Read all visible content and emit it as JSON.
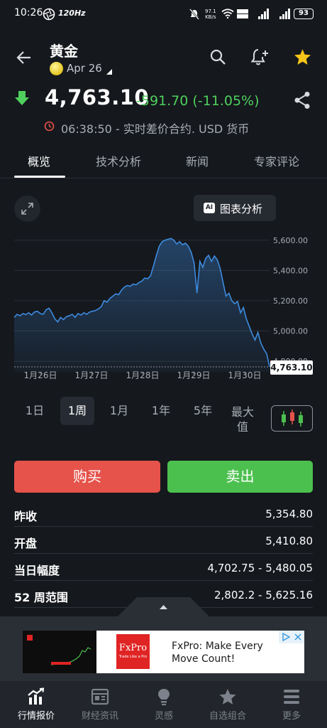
{
  "status_bar": {
    "time": "10:26",
    "refresh_rate": "120Hz",
    "net_speed": "97.1",
    "net_unit": "KB/s",
    "battery": "93"
  },
  "header": {
    "title": "黄金",
    "date": "Apr 26",
    "back_icon": "arrow-left-icon",
    "search_icon": "search-icon",
    "alert_icon": "bell-plus-icon",
    "star_icon": "star-icon",
    "star_color": "#f5c518"
  },
  "quote": {
    "price": "4,763.10",
    "change": "-591.70 (-11.05%)",
    "direction_icon": "arrow-down-icon",
    "direction_color": "#4fcf5d",
    "time": "06:38:50",
    "info": "- 实时差价合约. USD 货币"
  },
  "tabs": [
    {
      "label": "概览",
      "active": true
    },
    {
      "label": "技术分析",
      "active": false
    },
    {
      "label": "新闻",
      "active": false
    },
    {
      "label": "专家评论",
      "active": false
    }
  ],
  "chart_tools": {
    "analysis_label": "图表分析",
    "ai_badge": "AI"
  },
  "chart_data": {
    "type": "area",
    "x_ticks": [
      "1月26日",
      "1月27日",
      "1月28日",
      "1月29日",
      "1月30日"
    ],
    "y_ticks": [
      "5,600.00",
      "5,400.00",
      "5,200.00",
      "5,000.00",
      "4,800.00"
    ],
    "ylim": [
      4730,
      5660
    ],
    "last_value_label": "4,763.10",
    "values": [
      5090,
      5110,
      5100,
      5115,
      5108,
      5120,
      5105,
      5125,
      5130,
      5115,
      5110,
      5140,
      5150,
      5120,
      5080,
      5060,
      5090,
      5075,
      5095,
      5100,
      5110,
      5090,
      5115,
      5105,
      5120,
      5110,
      5125,
      5130,
      5135,
      5145,
      5160,
      5200,
      5190,
      5215,
      5230,
      5245,
      5240,
      5270,
      5290,
      5300,
      5295,
      5310,
      5305,
      5320,
      5330,
      5350,
      5345,
      5365,
      5430,
      5500,
      5560,
      5590,
      5600,
      5605,
      5612,
      5600,
      5575,
      5590,
      5570,
      5580,
      5560,
      5520,
      5450,
      5250,
      5460,
      5420,
      5480,
      5500,
      5460,
      5495,
      5470,
      5410,
      5320,
      5230,
      5250,
      5200,
      5180,
      5195,
      5120,
      5155,
      5080,
      5030,
      4980,
      4940,
      4990,
      4920,
      4880,
      4850,
      4763.1
    ],
    "line_color": "#3d8be0",
    "grid": true
  },
  "periods": [
    {
      "label": "1日",
      "active": false
    },
    {
      "label": "1周",
      "active": true
    },
    {
      "label": "1月",
      "active": false
    },
    {
      "label": "1年",
      "active": false
    },
    {
      "label": "5年",
      "active": false
    }
  ],
  "period_max": "最大值",
  "candle_icon": "candlestick-icon",
  "trade": {
    "buy": "购买",
    "sell": "卖出",
    "buy_color": "#e5534b",
    "sell_color": "#4cc04f"
  },
  "stats": [
    {
      "label": "昨收",
      "value": "5,354.80"
    },
    {
      "label": "开盘",
      "value": "5,410.80"
    },
    {
      "label": "当日幅度",
      "value": "4,702.75 - 5,480.05"
    },
    {
      "label": "52 周范围",
      "value": "2,802.2 - 5,625.16"
    }
  ],
  "ad": {
    "brand": "FxPro",
    "tagline": "Trade Like a Pro",
    "text": "FxPro: Make Every Move Count!"
  },
  "nav": [
    {
      "label": "行情报价",
      "icon": "chart-up-icon",
      "active": true
    },
    {
      "label": "财经资讯",
      "icon": "newspaper-icon",
      "active": false
    },
    {
      "label": "灵感",
      "icon": "lightbulb-icon",
      "active": false
    },
    {
      "label": "自选组合",
      "icon": "star-icon",
      "active": false
    },
    {
      "label": "更多",
      "icon": "menu-icon",
      "active": false
    }
  ]
}
